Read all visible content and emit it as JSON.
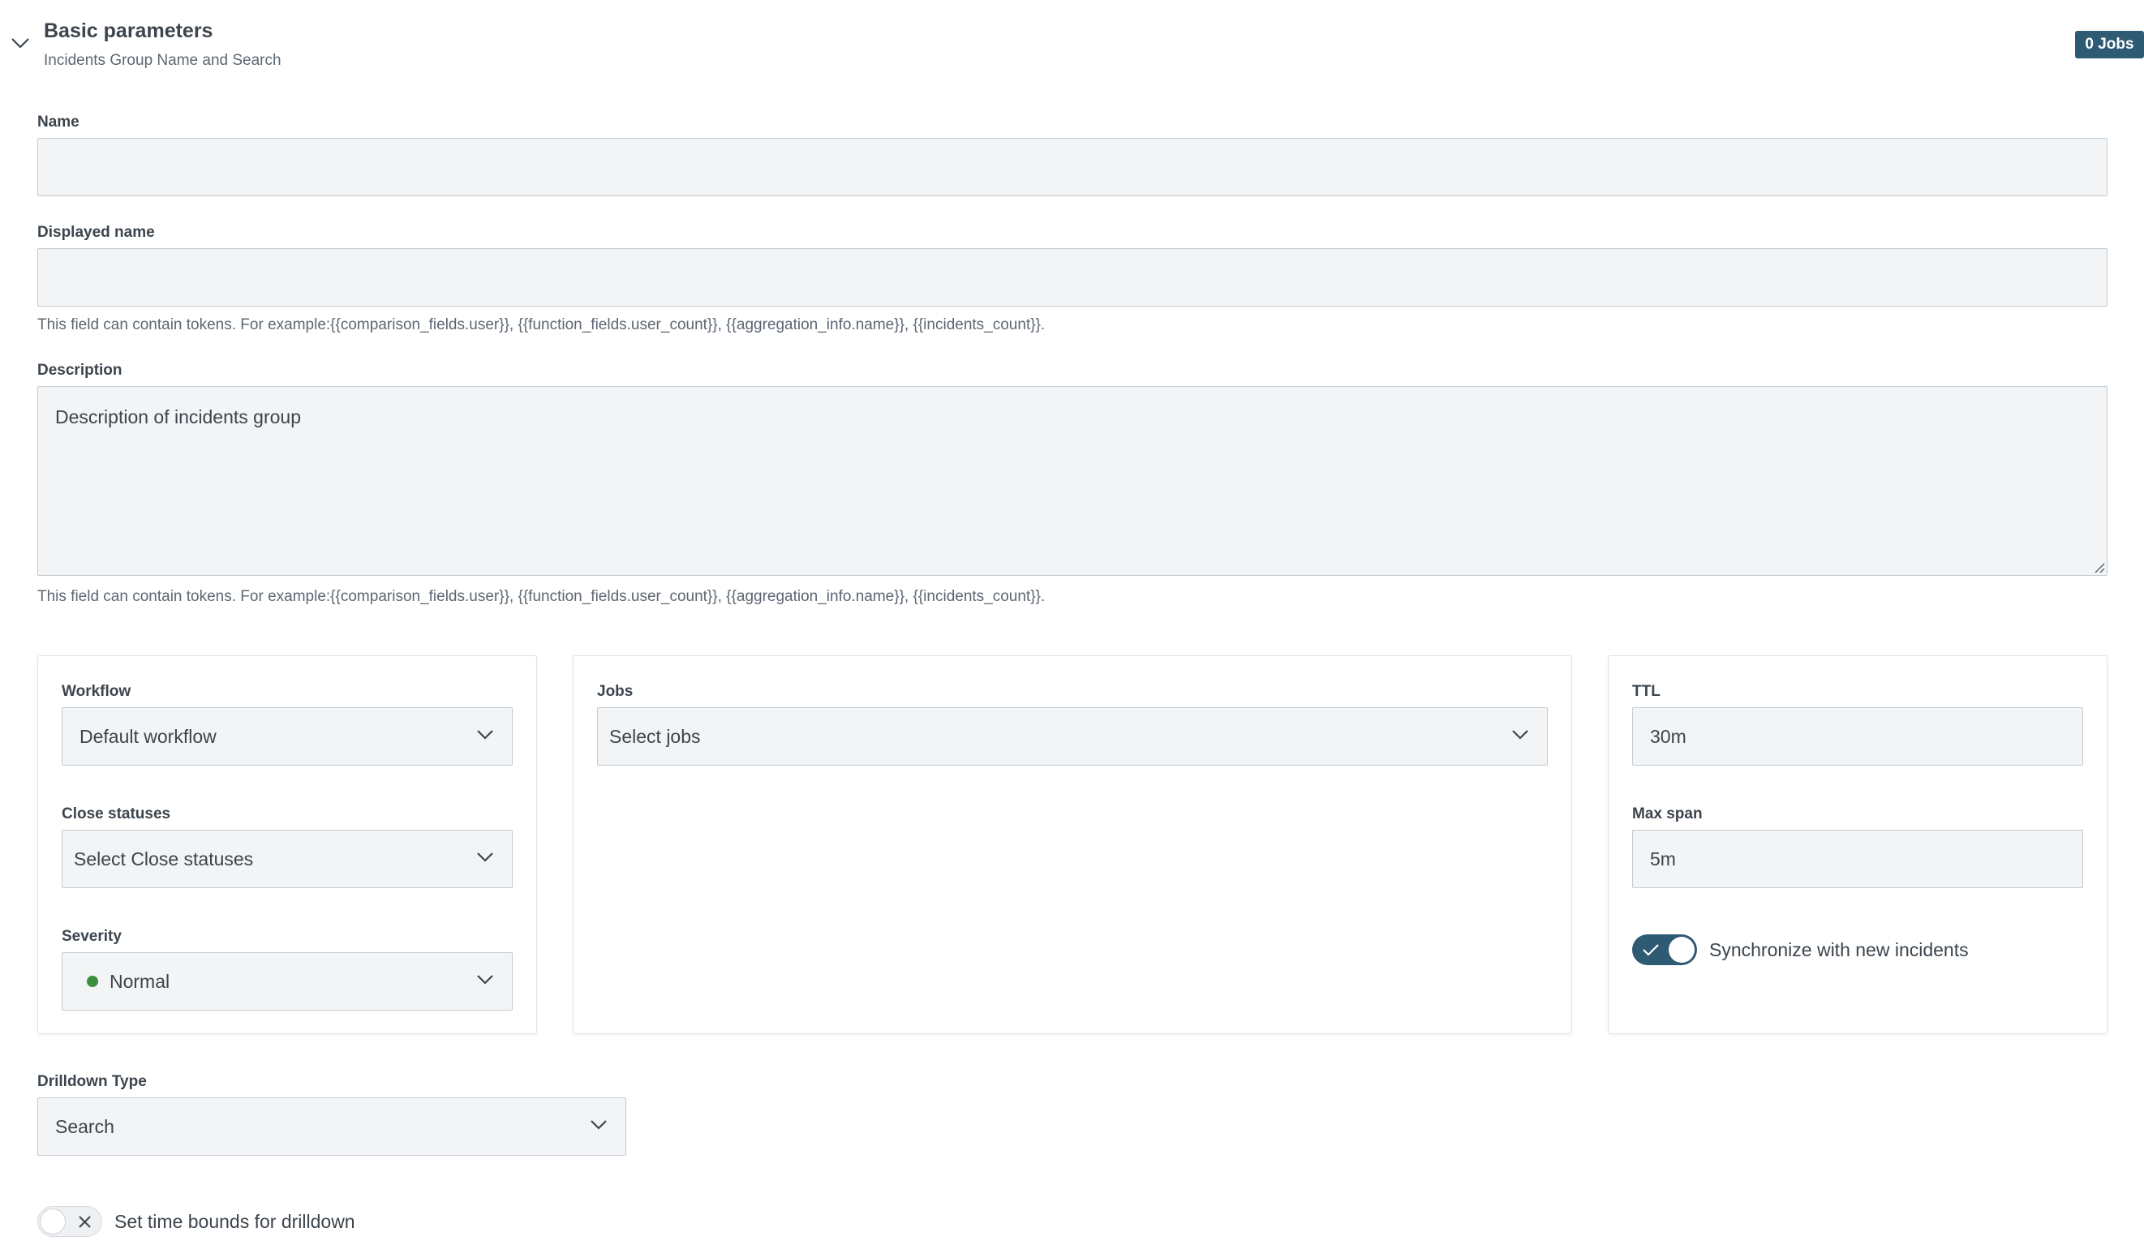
{
  "section": {
    "title": "Basic parameters",
    "subtitle": "Incidents Group Name and Search",
    "jobs_badge": "0 Jobs"
  },
  "fields": {
    "name": {
      "label": "Name",
      "value": ""
    },
    "displayed_name": {
      "label": "Displayed name",
      "value": "",
      "help": "This field can contain tokens. For example:{{comparison_fields.user}}, {{function_fields.user_count}}, {{aggregation_info.name}}, {{incidents_count}}."
    },
    "description": {
      "label": "Description",
      "value": "Description of incidents group",
      "help": "This field can contain tokens. For example:{{comparison_fields.user}}, {{function_fields.user_count}}, {{aggregation_info.name}}, {{incidents_count}}."
    }
  },
  "left_panel": {
    "workflow": {
      "label": "Workflow",
      "value": "Default workflow"
    },
    "close_statuses": {
      "label": "Close statuses",
      "value": "Select Close statuses"
    },
    "severity": {
      "label": "Severity",
      "value": "Normal",
      "dot_color": "#3b8f3e"
    }
  },
  "middle_panel": {
    "jobs": {
      "label": "Jobs",
      "value": "Select jobs"
    }
  },
  "right_panel": {
    "ttl": {
      "label": "TTL",
      "value": "30m"
    },
    "max_span": {
      "label": "Max span",
      "value": "5m"
    },
    "sync_toggle": {
      "label": "Synchronize with new incidents",
      "checked": true
    }
  },
  "drilldown": {
    "label": "Drilldown Type",
    "value": "Search",
    "time_bounds_toggle": {
      "label": "Set time bounds for drilldown",
      "checked": false
    }
  },
  "colors": {
    "accent": "#2f5a74",
    "input_bg": "#f3f4f5",
    "severity_normal": "#3b8f3e"
  }
}
